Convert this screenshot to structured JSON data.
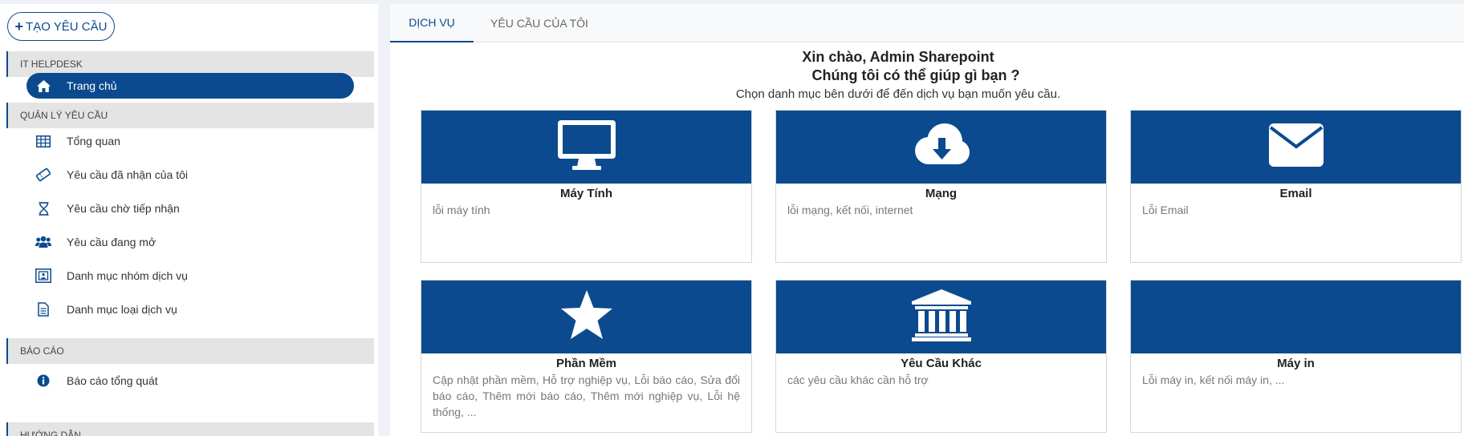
{
  "sidebar": {
    "create_button": "TẠO YÊU CẦU",
    "sections": [
      {
        "title": "IT HELPDESK"
      },
      {
        "title": "QUẢN LÝ YÊU CẦU"
      },
      {
        "title": "BÁO CÁO"
      },
      {
        "title": "HƯỚNG DẪN"
      }
    ],
    "items": [
      {
        "label": "Trang chủ",
        "icon": "home-icon"
      },
      {
        "label": "Tổng quan",
        "icon": "table-icon"
      },
      {
        "label": "Yêu cầu đã nhận của tôi",
        "icon": "ticket-icon"
      },
      {
        "label": "Yêu cầu chờ tiếp nhận",
        "icon": "hourglass-icon"
      },
      {
        "label": "Yêu cầu đang mở",
        "icon": "users-icon"
      },
      {
        "label": "Danh mục nhóm dịch vụ",
        "icon": "group-frame-icon"
      },
      {
        "label": "Danh mục loại dịch vụ",
        "icon": "document-icon"
      },
      {
        "label": "Báo cáo tổng quát",
        "icon": "info-icon"
      }
    ]
  },
  "tabs": [
    {
      "label": "DỊCH VỤ",
      "active": true
    },
    {
      "label": "YÊU CẦU CỦA TÔI",
      "active": false
    }
  ],
  "greeting": {
    "line1": "Xin chào, Admin Sharepoint",
    "line2": "Chúng tôi có thể giúp gì bạn ?",
    "line3": "Chọn danh mục bên dưới để đến dịch vụ bạn muốn yêu cầu."
  },
  "cards": [
    {
      "title": "Máy Tính",
      "desc": "lỗi máy tính",
      "icon": "monitor-icon"
    },
    {
      "title": "Mạng",
      "desc": "lỗi mạng, kết nối, internet",
      "icon": "cloud-download-icon"
    },
    {
      "title": "Email",
      "desc": "Lỗi Email",
      "icon": "envelope-icon"
    },
    {
      "title": "Phần Mềm",
      "desc": "Cập nhật phần mềm, Hỗ trợ nghiệp vụ, Lỗi báo cáo, Sửa đổi báo cáo, Thêm mới báo cáo, Thêm mới nghiệp vụ, Lỗi hệ thống, ...",
      "icon": "star-icon"
    },
    {
      "title": "Yêu Cầu Khác",
      "desc": "các yêu cầu khác cần hỗ trợ",
      "icon": "bank-icon"
    },
    {
      "title": "Máy in",
      "desc": "Lỗi máy in, kết nối máy in, ...",
      "icon": ""
    }
  ],
  "colors": {
    "primary": "#0b4a8f",
    "section_bg": "#e4e4e4",
    "page_bg": "#eef1f5"
  }
}
